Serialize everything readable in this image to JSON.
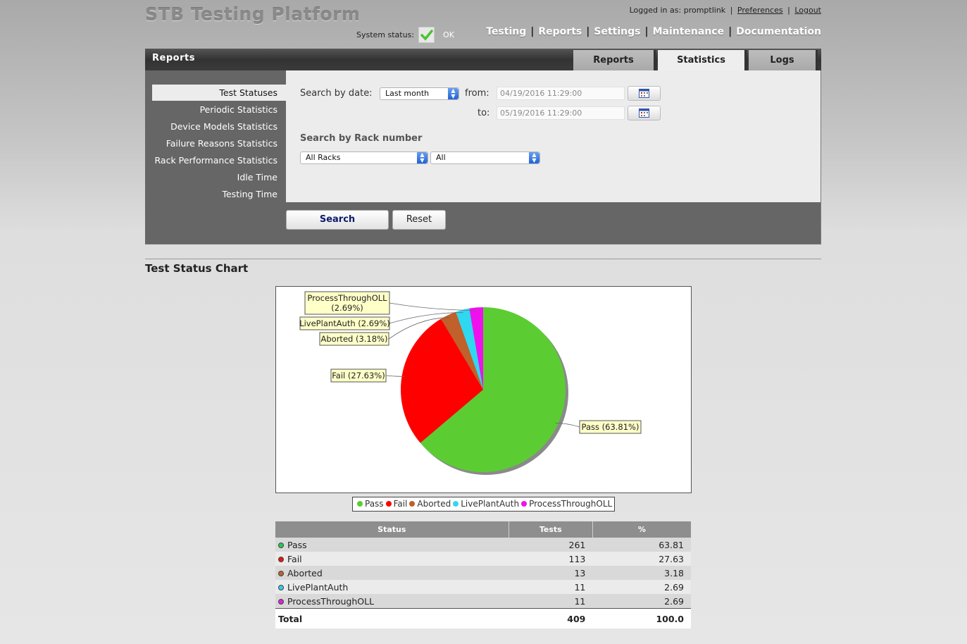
{
  "header": {
    "app_title": "STB Testing Platform",
    "logged_in_label": "Logged in as:",
    "username": "promptlink",
    "preferences": "Preferences",
    "logout": "Logout",
    "system_status_label": "System status:",
    "system_status_value": "OK",
    "nav": [
      "Testing",
      "Reports",
      "Settings",
      "Maintenance",
      "Documentation"
    ]
  },
  "panel": {
    "title": "Reports",
    "tabs": [
      {
        "label": "Reports",
        "active": false
      },
      {
        "label": "Statistics",
        "active": true
      },
      {
        "label": "Logs",
        "active": false
      }
    ]
  },
  "sidebar": {
    "items": [
      {
        "label": "Test Statuses",
        "active": true
      },
      {
        "label": "Periodic Statistics",
        "active": false
      },
      {
        "label": "Device Models Statistics",
        "active": false
      },
      {
        "label": "Failure Reasons Statistics",
        "active": false
      },
      {
        "label": "Rack Performance Statistics",
        "active": false
      },
      {
        "label": "Idle Time",
        "active": false
      },
      {
        "label": "Testing Time",
        "active": false
      }
    ]
  },
  "search": {
    "by_date_label": "Search by date:",
    "date_preset": "Last month",
    "from_label": "from:",
    "from_value": "04/19/2016 11:29:00",
    "to_label": "to:",
    "to_value": "05/19/2016 11:29:00",
    "by_rack_label": "Search by Rack number",
    "rack_select": "All Racks",
    "sub_select": "All",
    "search_button": "Search",
    "reset_button": "Reset"
  },
  "chart_section_title": "Test Status Chart",
  "chart_data": {
    "type": "pie",
    "title": "",
    "categories": [
      "Pass",
      "Fail",
      "Aborted",
      "LivePlantAuth",
      "ProcessThroughOLL"
    ],
    "values": [
      63.81,
      27.63,
      3.18,
      2.69,
      2.69
    ],
    "labels": [
      "Pass (63.81%)",
      "Fail (27.63%)",
      "Aborted (3.18%)",
      "LivePlantAuth (2.69%)",
      "ProcessThroughOLL (2.69%)"
    ],
    "colors": [
      "#5ccc33",
      "#ff0000",
      "#c0602b",
      "#2fd8f0",
      "#ee11ee"
    ],
    "legend_position": "bottom"
  },
  "table": {
    "headers": [
      "Status",
      "Tests",
      "%"
    ],
    "rows": [
      {
        "status": "Pass",
        "tests": "261",
        "pct": "63.81",
        "dot": "#22cc55"
      },
      {
        "status": "Fail",
        "tests": "113",
        "pct": "27.63",
        "dot": "#ee1111"
      },
      {
        "status": "Aborted",
        "tests": "13",
        "pct": "3.18",
        "dot": "#b8652b"
      },
      {
        "status": "LivePlantAuth",
        "tests": "11",
        "pct": "2.69",
        "dot": "#33ccee"
      },
      {
        "status": "ProcessThroughOLL",
        "tests": "11",
        "pct": "2.69",
        "dot": "#dd22dd"
      }
    ],
    "total": {
      "label": "Total",
      "tests": "409",
      "pct": "100.0"
    }
  }
}
